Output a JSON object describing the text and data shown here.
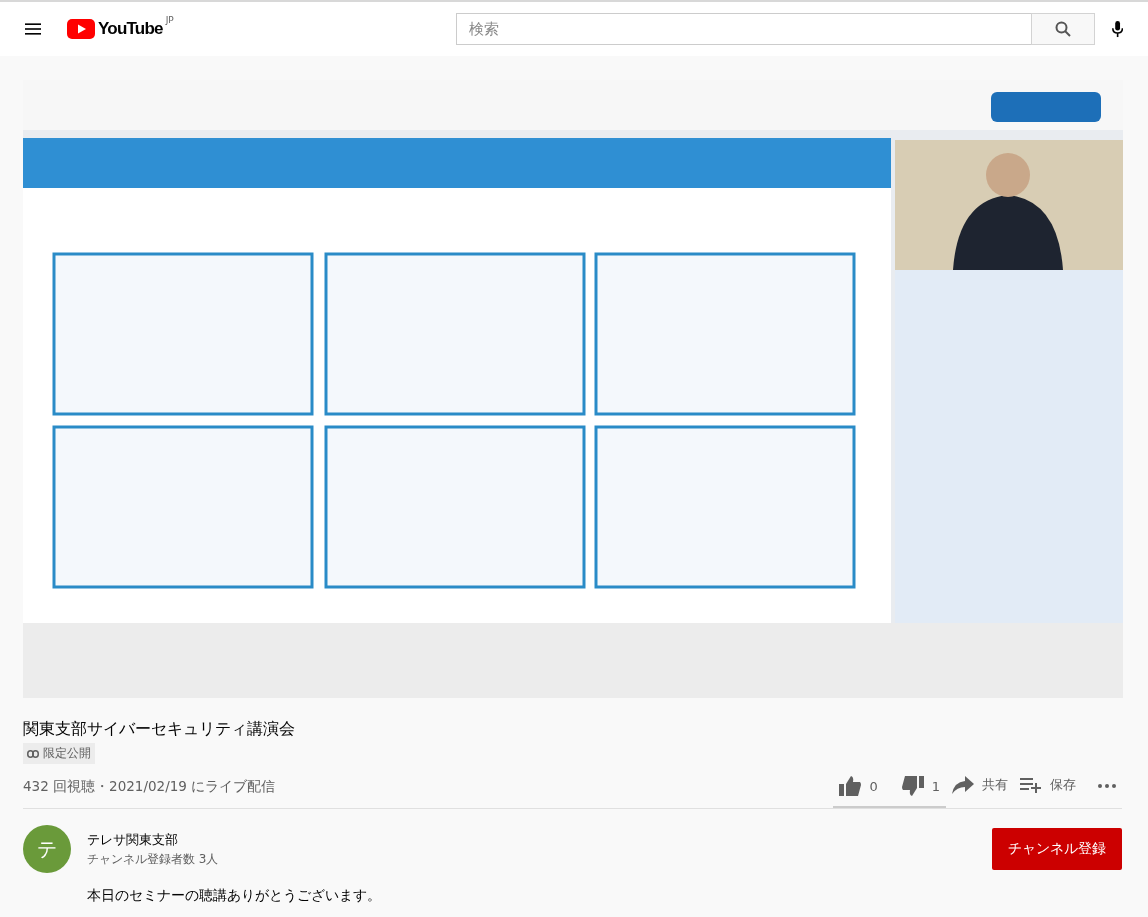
{
  "header": {
    "logo": "YouTube",
    "region": "JP",
    "search": {
      "placeholder": "検索"
    }
  },
  "title": "関東支部サイバーセキュリティ講演会",
  "privacy_badge": "限定公開",
  "stats": "432 回視聴・2021/02/19 にライブ配信",
  "actions": {
    "likes": "0",
    "dislikes": "1",
    "share": "共有",
    "save": "保存"
  },
  "sentiment_bar": {
    "level": 0
  },
  "channel": {
    "avatar_letter": "テ",
    "color": "#6a9a3a",
    "name": "テレサ関東支部",
    "subscribers": "チャンネル登録者数 3人",
    "subscribe": "チャンネル登録"
  },
  "description": "本日のセミナーの聴講ありがとうございます。"
}
